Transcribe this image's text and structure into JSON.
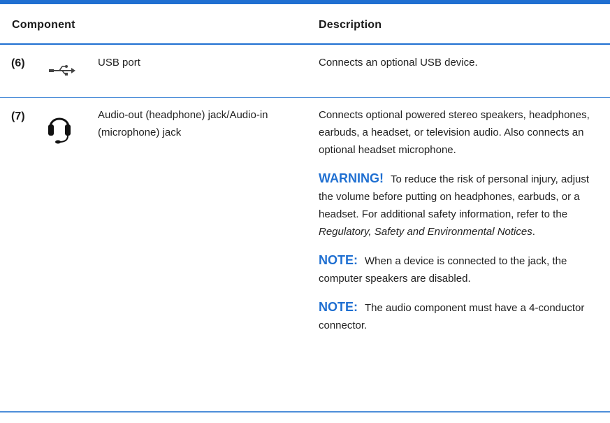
{
  "table": {
    "header": {
      "component": "Component",
      "description": "Description"
    },
    "rows": [
      {
        "number": "(6)",
        "icon": "usb-icon",
        "component": "USB port",
        "description": "Connects an optional USB device."
      },
      {
        "number": "(7)",
        "icon": "headset-icon",
        "component": "Audio-out (headphone) jack/Audio-in (microphone) jack",
        "description": "Connects optional powered stereo speakers, headphones, earbuds, a headset, or television audio. Also connects an optional headset microphone.",
        "warning": {
          "label": "WARNING!",
          "text": "To reduce the risk of personal injury, adjust the volume before putting on headphones, earbuds, or a headset. For additional safety information, refer to the",
          "doc_title": "Regulatory, Safety and Environmental Notices",
          "end": "."
        },
        "notes": [
          {
            "label": "NOTE:",
            "text": "When a device is connected to the jack, the computer speakers are disabled."
          },
          {
            "label": "NOTE:",
            "text": "The audio component must have a 4-conductor connector."
          }
        ]
      }
    ]
  },
  "colors": {
    "accent": "#1f6fd1",
    "rule": "#4d8ed9",
    "text": "#222222"
  }
}
